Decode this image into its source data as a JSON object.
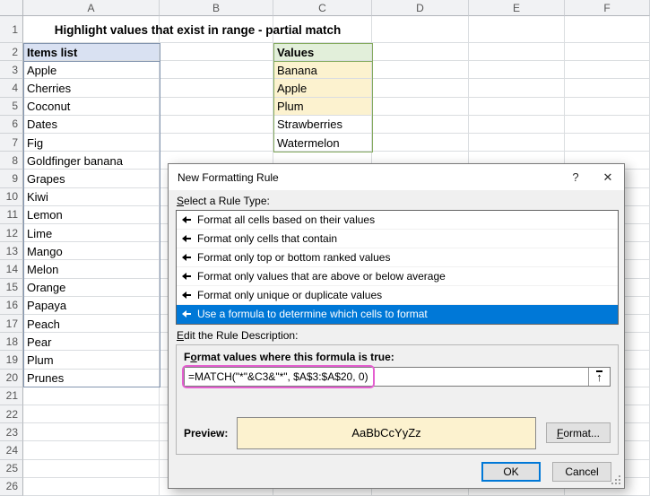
{
  "spreadsheet": {
    "title": "Highlight values that exist in range - partial match",
    "columns": [
      "A",
      "B",
      "C",
      "D",
      "E",
      "F"
    ],
    "row_count": 26,
    "items_header": "Items list",
    "items": [
      "Apple",
      "Cherries",
      "Coconut",
      "Dates",
      "Fig",
      "Goldfinger banana",
      "Grapes",
      "Kiwi",
      "Lemon",
      "Lime",
      "Mango",
      "Melon",
      "Orange",
      "Papaya",
      "Peach",
      "Pear",
      "Plum",
      "Prunes"
    ],
    "values_header": "Values",
    "values": [
      "Banana",
      "Apple",
      "Plum",
      "Strawberries",
      "Watermelon"
    ],
    "highlighted_values": [
      "Banana",
      "Apple",
      "Plum"
    ],
    "colors": {
      "items_header_fill": "#d9e1f2",
      "values_header_fill": "#e2efda",
      "highlight_fill": "#fcf2cf",
      "items_range_border": "#8496b0",
      "values_range_border": "#85ab5f"
    }
  },
  "dialog": {
    "title": "New Formatting Rule",
    "icons": {
      "help": "?",
      "close": "✕",
      "collapse": "↑",
      "rule_type_arrow": "left-arrow"
    },
    "rule_type_label": {
      "accel": "S",
      "post": "elect a Rule Type:"
    },
    "rule_types": [
      "Format all cells based on their values",
      "Format only cells that contain",
      "Format only top or bottom ranked values",
      "Format only values that are above or below average",
      "Format only unique or duplicate values",
      "Use a formula to determine which cells to format"
    ],
    "selected_rule_index": 5,
    "description_label": {
      "accel": "E",
      "post": "dit the Rule Description:"
    },
    "formula_label": {
      "pre": "F",
      "accel": "o",
      "post": "rmat values where this formula is true:"
    },
    "formula": "=MATCH(\"*\"&C3&\"*\", $A$3:$A$20, 0)",
    "preview_label": "Preview:",
    "preview_text": "AaBbCcYyZz",
    "format_button": {
      "accel": "F",
      "post": "ormat..."
    },
    "ok_button": "OK",
    "cancel_button": "Cancel",
    "colors": {
      "selection_blue": "#0078d7",
      "formula_outline": "#e45fd0",
      "preview_fill": "#fcf2cf"
    }
  }
}
